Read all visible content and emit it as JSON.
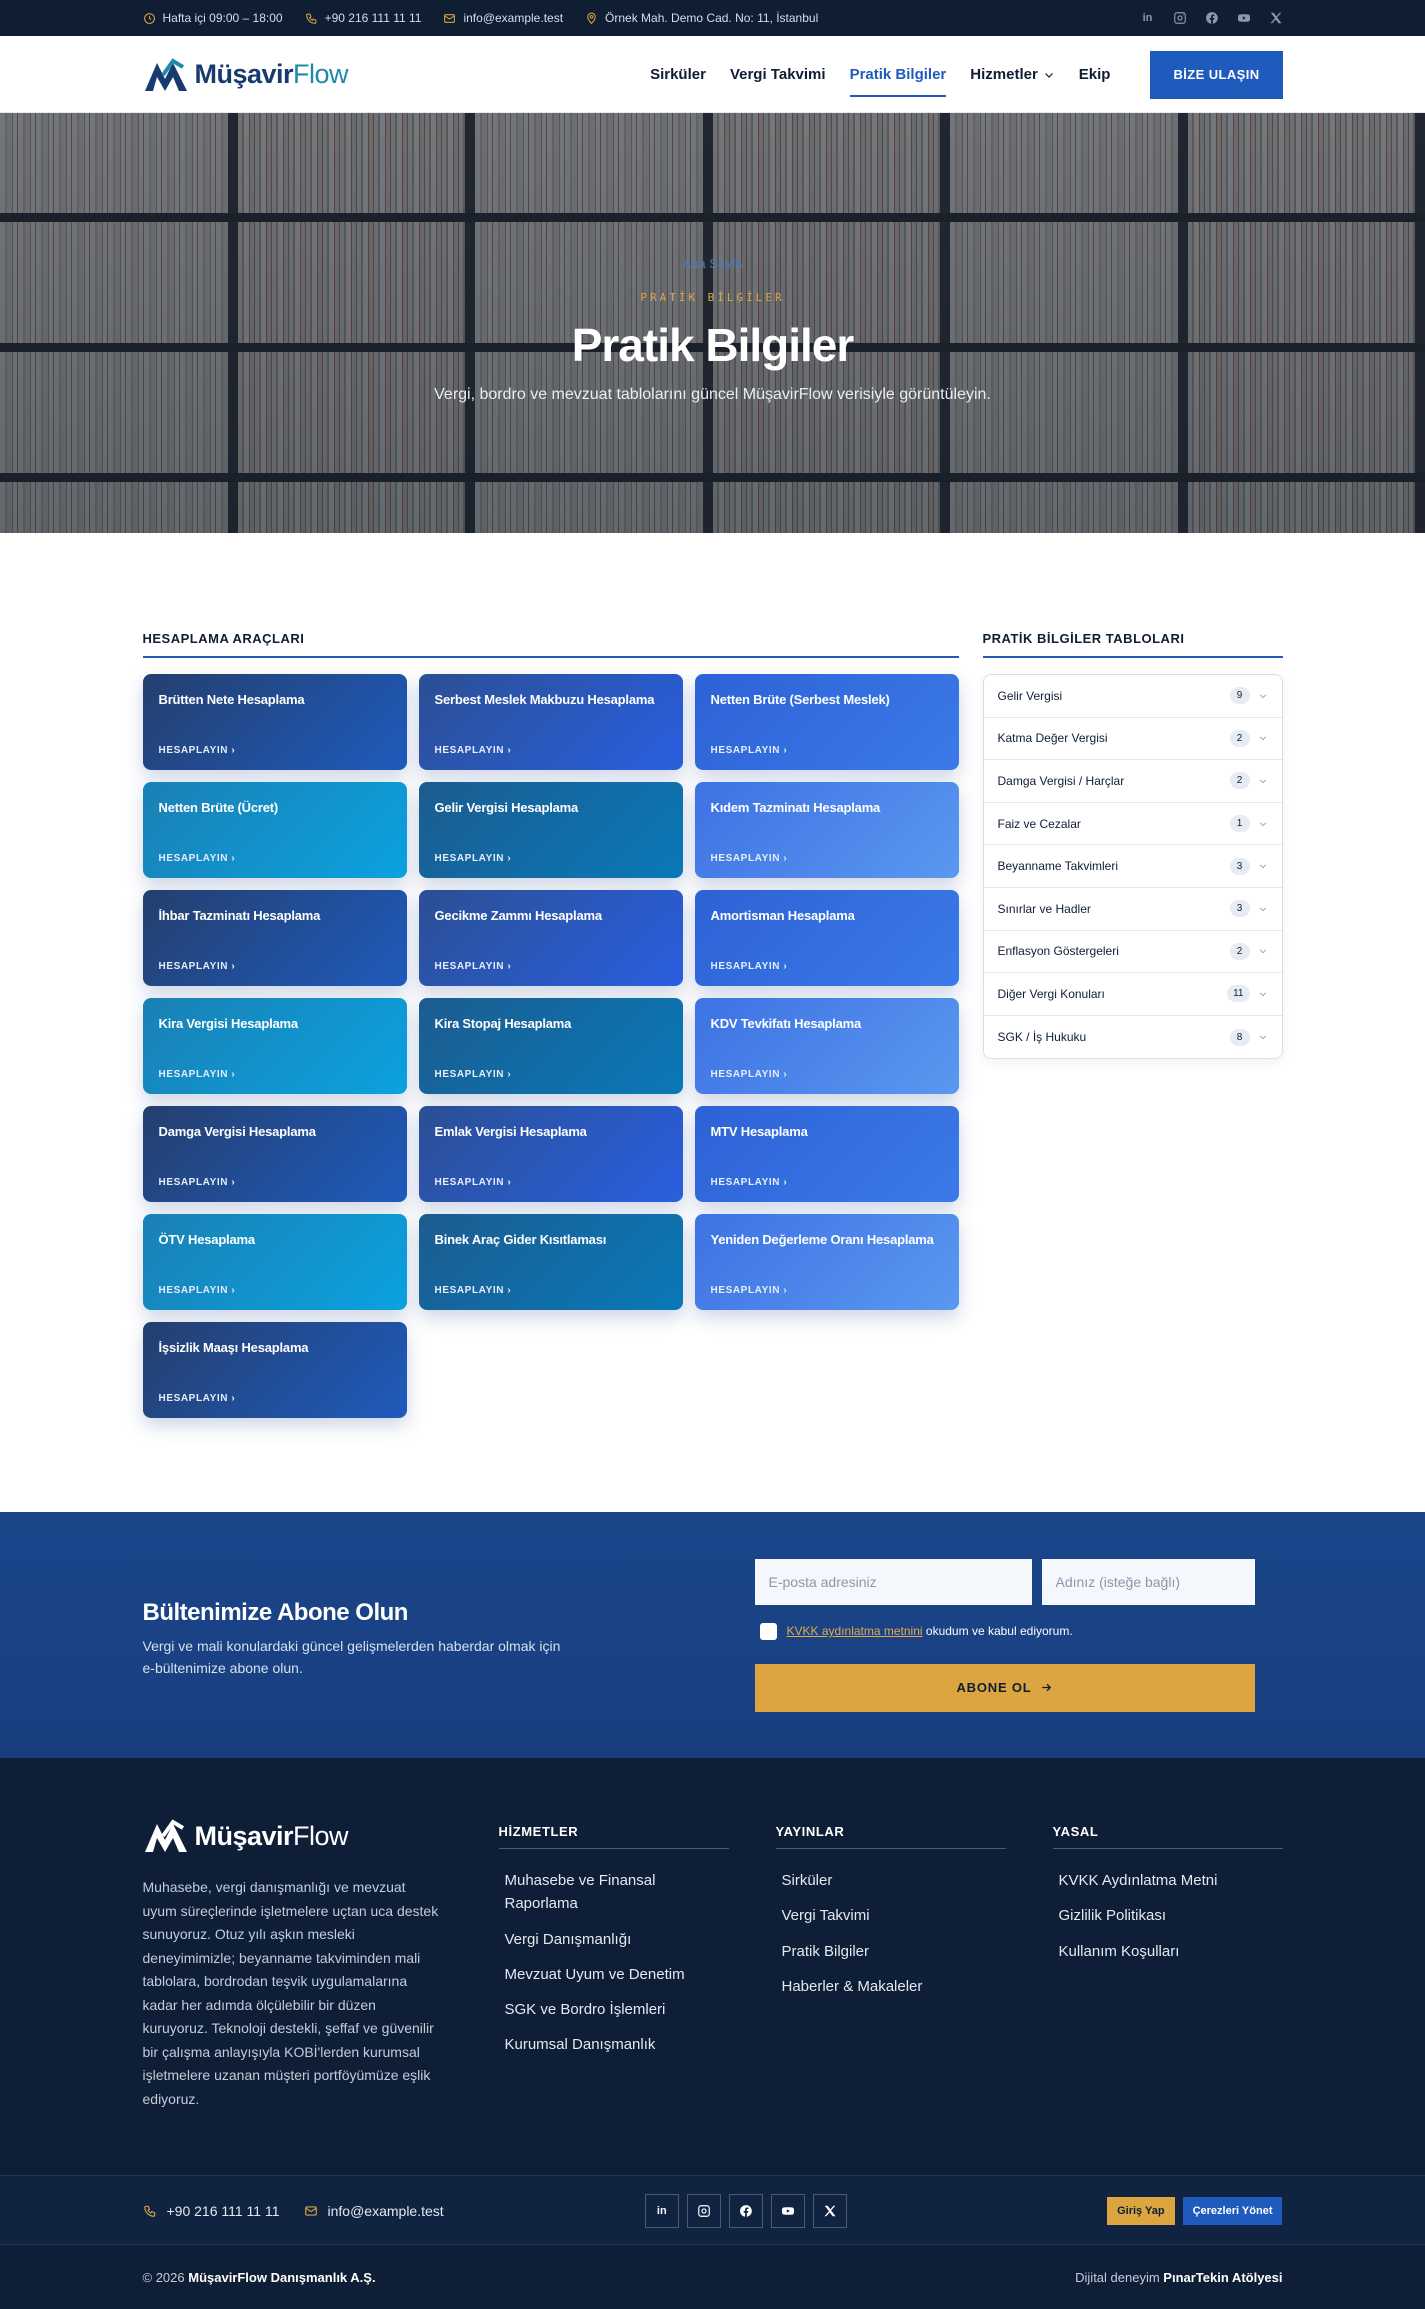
{
  "topbar": {
    "hours": "Hafta içi 09:00 – 18:00",
    "phone": "+90 216 111 11 11",
    "email": "info@example.test",
    "address": "Örnek Mah. Demo Cad. No: 11, İstanbul",
    "socials": [
      "linkedin-icon",
      "instagram-icon",
      "facebook-icon",
      "youtube-icon",
      "x-icon"
    ]
  },
  "header": {
    "logo_part1": "Müşavir",
    "logo_part2": "Flow",
    "nav": [
      "Sirküler",
      "Vergi Takvimi",
      "Pratik Bilgiler",
      "Hizmetler",
      "Ekip"
    ],
    "active_nav": "Pratik Bilgiler",
    "cta": "BİZE ULAŞIN"
  },
  "hero": {
    "breadcrumb": "Ana Sayfa",
    "eyebrow": "PRATİK BİLGİLER",
    "title": "Pratik Bilgiler",
    "subtitle": "Vergi, bordro ve mevzuat tablolarını güncel MüşavirFlow verisiyle görüntüleyin."
  },
  "tools": {
    "title": "HESAPLAMA ARAÇLARI",
    "link_label": "HESAPLAYIN ›",
    "items": [
      "Brütten Nete Hesaplama",
      "Serbest Meslek Makbuzu Hesaplama",
      "Netten Brüte (Serbest Meslek)",
      "Netten Brüte (Ücret)",
      "Gelir Vergisi Hesaplama",
      "Kıdem Tazminatı Hesaplama",
      "İhbar Tazminatı Hesaplama",
      "Gecikme Zammı Hesaplama",
      "Amortisman Hesaplama",
      "Kira Vergisi Hesaplama",
      "Kira Stopaj Hesaplama",
      "KDV Tevkifatı Hesaplama",
      "Damga Vergisi Hesaplama",
      "Emlak Vergisi Hesaplama",
      "MTV Hesaplama",
      "ÖTV Hesaplama",
      "Binek Araç Gider Kısıtlaması",
      "Yeniden Değerleme Oranı Hesaplama",
      "İşsizlik Maaşı Hesaplama"
    ]
  },
  "tables": {
    "title": "PRATİK BİLGİLER TABLOLARI",
    "items": [
      {
        "label": "Gelir Vergisi",
        "count": "9"
      },
      {
        "label": "Katma Değer Vergisi",
        "count": "2"
      },
      {
        "label": "Damga Vergisi / Harçlar",
        "count": "2"
      },
      {
        "label": "Faiz ve Cezalar",
        "count": "1"
      },
      {
        "label": "Beyanname Takvimleri",
        "count": "3"
      },
      {
        "label": "Sınırlar ve Hadler",
        "count": "3"
      },
      {
        "label": "Enflasyon Göstergeleri",
        "count": "2"
      },
      {
        "label": "Diğer Vergi Konuları",
        "count": "11"
      },
      {
        "label": "SGK / İş Hukuku",
        "count": "8"
      }
    ]
  },
  "newsletter": {
    "title": "Bültenimize Abone Olun",
    "desc": "Vergi ve mali konulardaki güncel gelişmelerden haberdar olmak için e-bültenimize abone olun.",
    "email_placeholder": "E-posta adresiniz",
    "name_placeholder": "Adınız (isteğe bağlı)",
    "kvkk_link": "KVKK aydınlatma metnini",
    "kvkk_text": " okudum ve kabul ediyorum.",
    "button": "ABONE OL"
  },
  "footer": {
    "about": "Muhasebe, vergi danışmanlığı ve mevzuat uyum süreçlerinde işletmelere uçtan uca destek sunuyoruz. Otuz yılı aşkın mesleki deneyimimizle; beyanname takviminden mali tablolara, bordrodan teşvik uygulamalarına kadar her adımda ölçülebilir bir düzen kuruyoruz. Teknoloji destekli, şeffaf ve güvenilir bir çalışma anlayışıyla KOBİ'lerden kurumsal işletmelere uzanan müşteri portföyümüze eşlik ediyoruz.",
    "columns": [
      {
        "title": "HİZMETLER",
        "links": [
          "Muhasebe ve Finansal Raporlama",
          "Vergi Danışmanlığı",
          "Mevzuat Uyum ve Denetim",
          "SGK ve Bordro İşlemleri",
          "Kurumsal Danışmanlık"
        ]
      },
      {
        "title": "YAYINLAR",
        "links": [
          "Sirküler",
          "Vergi Takvimi",
          "Pratik Bilgiler",
          "Haberler & Makaleler"
        ]
      },
      {
        "title": "YASAL",
        "links": [
          "KVKK Aydınlatma Metni",
          "Gizlilik Politikası",
          "Kullanım Koşulları"
        ]
      }
    ],
    "phone": "+90 216 111 11 11",
    "email": "info@example.test",
    "login_button": "Giriş Yap",
    "cookie_button": "Çerezleri Yönet",
    "copyright_prefix": "© 2026 ",
    "company": "MüşavirFlow Danışmanlık A.Ş.",
    "credit_prefix": "Dijital deneyim ",
    "credit_name": "PınarTekin Atölyesi"
  },
  "colors": {
    "navy": "#0f1e33",
    "primary": "#1f5bbd",
    "gold": "#dca53f",
    "newsletter_bg": "#1b468b"
  }
}
